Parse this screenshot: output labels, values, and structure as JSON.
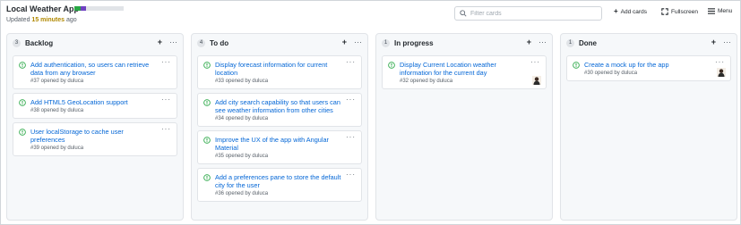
{
  "app": {
    "title": "Local Weather App",
    "updated_prefix": "Updated ",
    "updated_strong": "15 minutes",
    "updated_suffix": " ago",
    "progress": [
      {
        "fraction": 0.12,
        "color": "#28a745"
      },
      {
        "fraction": 0.12,
        "color": "#6f42c1"
      },
      {
        "fraction": 0.76,
        "color": "#e1e4e8"
      }
    ]
  },
  "toolbar": {
    "filter_placeholder": "Filter cards",
    "add_cards": "Add cards",
    "fullscreen": "Fullscreen",
    "menu": "Menu"
  },
  "columns": [
    {
      "count": "3",
      "name": "Backlog",
      "cards": [
        {
          "title": "Add authentication, so users can retrieve data from any browser",
          "meta": "#37 opened by duluca"
        },
        {
          "title": "Add HTML5 GeoLocation support",
          "meta": "#38 opened by duluca"
        },
        {
          "title": "User localStorage to cache user preferences",
          "meta": "#39 opened by duluca"
        }
      ]
    },
    {
      "count": "4",
      "name": "To do",
      "cards": [
        {
          "title": "Display forecast information for current location",
          "meta": "#33 opened by duluca"
        },
        {
          "title": "Add city search capability so that users can see weather information from other cities",
          "meta": "#34 opened by duluca"
        },
        {
          "title": "Improve the UX of the app with Angular Material",
          "meta": "#35 opened by duluca"
        },
        {
          "title": "Add a preferences pane to store the default city for the user",
          "meta": "#36 opened by duluca"
        }
      ]
    },
    {
      "count": "1",
      "name": "In progress",
      "cards": [
        {
          "title": "Display Current Location weather information for the current day",
          "meta": "#32 opened by duluca",
          "avatar": true
        }
      ]
    },
    {
      "count": "1",
      "name": "Done",
      "cards": [
        {
          "title": "Create a mock up for the app",
          "meta": "#30 opened by duluca",
          "avatar": true
        }
      ]
    }
  ],
  "colors": {
    "link": "#0366d6",
    "open_issue": "#28a745",
    "column_bg": "#f6f8fa"
  }
}
